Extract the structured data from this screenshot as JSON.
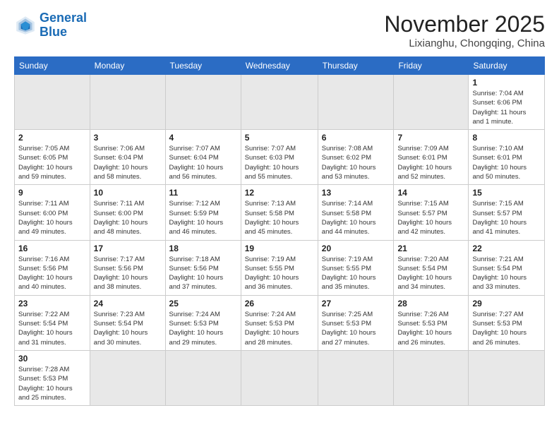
{
  "header": {
    "logo_line1": "General",
    "logo_line2": "Blue",
    "month": "November 2025",
    "location": "Lixianghu, Chongqing, China"
  },
  "weekdays": [
    "Sunday",
    "Monday",
    "Tuesday",
    "Wednesday",
    "Thursday",
    "Friday",
    "Saturday"
  ],
  "days": [
    {
      "num": "",
      "info": "",
      "empty": true
    },
    {
      "num": "",
      "info": "",
      "empty": true
    },
    {
      "num": "",
      "info": "",
      "empty": true
    },
    {
      "num": "",
      "info": "",
      "empty": true
    },
    {
      "num": "",
      "info": "",
      "empty": true
    },
    {
      "num": "",
      "info": "",
      "empty": true
    },
    {
      "num": "1",
      "info": "Sunrise: 7:04 AM\nSunset: 6:06 PM\nDaylight: 11 hours\nand 1 minute."
    },
    {
      "num": "2",
      "info": "Sunrise: 7:05 AM\nSunset: 6:05 PM\nDaylight: 10 hours\nand 59 minutes."
    },
    {
      "num": "3",
      "info": "Sunrise: 7:06 AM\nSunset: 6:04 PM\nDaylight: 10 hours\nand 58 minutes."
    },
    {
      "num": "4",
      "info": "Sunrise: 7:07 AM\nSunset: 6:04 PM\nDaylight: 10 hours\nand 56 minutes."
    },
    {
      "num": "5",
      "info": "Sunrise: 7:07 AM\nSunset: 6:03 PM\nDaylight: 10 hours\nand 55 minutes."
    },
    {
      "num": "6",
      "info": "Sunrise: 7:08 AM\nSunset: 6:02 PM\nDaylight: 10 hours\nand 53 minutes."
    },
    {
      "num": "7",
      "info": "Sunrise: 7:09 AM\nSunset: 6:01 PM\nDaylight: 10 hours\nand 52 minutes."
    },
    {
      "num": "8",
      "info": "Sunrise: 7:10 AM\nSunset: 6:01 PM\nDaylight: 10 hours\nand 50 minutes."
    },
    {
      "num": "9",
      "info": "Sunrise: 7:11 AM\nSunset: 6:00 PM\nDaylight: 10 hours\nand 49 minutes."
    },
    {
      "num": "10",
      "info": "Sunrise: 7:11 AM\nSunset: 6:00 PM\nDaylight: 10 hours\nand 48 minutes."
    },
    {
      "num": "11",
      "info": "Sunrise: 7:12 AM\nSunset: 5:59 PM\nDaylight: 10 hours\nand 46 minutes."
    },
    {
      "num": "12",
      "info": "Sunrise: 7:13 AM\nSunset: 5:58 PM\nDaylight: 10 hours\nand 45 minutes."
    },
    {
      "num": "13",
      "info": "Sunrise: 7:14 AM\nSunset: 5:58 PM\nDaylight: 10 hours\nand 44 minutes."
    },
    {
      "num": "14",
      "info": "Sunrise: 7:15 AM\nSunset: 5:57 PM\nDaylight: 10 hours\nand 42 minutes."
    },
    {
      "num": "15",
      "info": "Sunrise: 7:15 AM\nSunset: 5:57 PM\nDaylight: 10 hours\nand 41 minutes."
    },
    {
      "num": "16",
      "info": "Sunrise: 7:16 AM\nSunset: 5:56 PM\nDaylight: 10 hours\nand 40 minutes."
    },
    {
      "num": "17",
      "info": "Sunrise: 7:17 AM\nSunset: 5:56 PM\nDaylight: 10 hours\nand 38 minutes."
    },
    {
      "num": "18",
      "info": "Sunrise: 7:18 AM\nSunset: 5:56 PM\nDaylight: 10 hours\nand 37 minutes."
    },
    {
      "num": "19",
      "info": "Sunrise: 7:19 AM\nSunset: 5:55 PM\nDaylight: 10 hours\nand 36 minutes."
    },
    {
      "num": "20",
      "info": "Sunrise: 7:19 AM\nSunset: 5:55 PM\nDaylight: 10 hours\nand 35 minutes."
    },
    {
      "num": "21",
      "info": "Sunrise: 7:20 AM\nSunset: 5:54 PM\nDaylight: 10 hours\nand 34 minutes."
    },
    {
      "num": "22",
      "info": "Sunrise: 7:21 AM\nSunset: 5:54 PM\nDaylight: 10 hours\nand 33 minutes."
    },
    {
      "num": "23",
      "info": "Sunrise: 7:22 AM\nSunset: 5:54 PM\nDaylight: 10 hours\nand 31 minutes."
    },
    {
      "num": "24",
      "info": "Sunrise: 7:23 AM\nSunset: 5:54 PM\nDaylight: 10 hours\nand 30 minutes."
    },
    {
      "num": "25",
      "info": "Sunrise: 7:24 AM\nSunset: 5:53 PM\nDaylight: 10 hours\nand 29 minutes."
    },
    {
      "num": "26",
      "info": "Sunrise: 7:24 AM\nSunset: 5:53 PM\nDaylight: 10 hours\nand 28 minutes."
    },
    {
      "num": "27",
      "info": "Sunrise: 7:25 AM\nSunset: 5:53 PM\nDaylight: 10 hours\nand 27 minutes."
    },
    {
      "num": "28",
      "info": "Sunrise: 7:26 AM\nSunset: 5:53 PM\nDaylight: 10 hours\nand 26 minutes."
    },
    {
      "num": "29",
      "info": "Sunrise: 7:27 AM\nSunset: 5:53 PM\nDaylight: 10 hours\nand 26 minutes."
    },
    {
      "num": "30",
      "info": "Sunrise: 7:28 AM\nSunset: 5:53 PM\nDaylight: 10 hours\nand 25 minutes.",
      "last": true
    },
    {
      "num": "",
      "info": "",
      "empty": true,
      "last": true
    },
    {
      "num": "",
      "info": "",
      "empty": true,
      "last": true
    },
    {
      "num": "",
      "info": "",
      "empty": true,
      "last": true
    },
    {
      "num": "",
      "info": "",
      "empty": true,
      "last": true
    },
    {
      "num": "",
      "info": "",
      "empty": true,
      "last": true
    },
    {
      "num": "",
      "info": "",
      "empty": true,
      "last": true
    }
  ]
}
